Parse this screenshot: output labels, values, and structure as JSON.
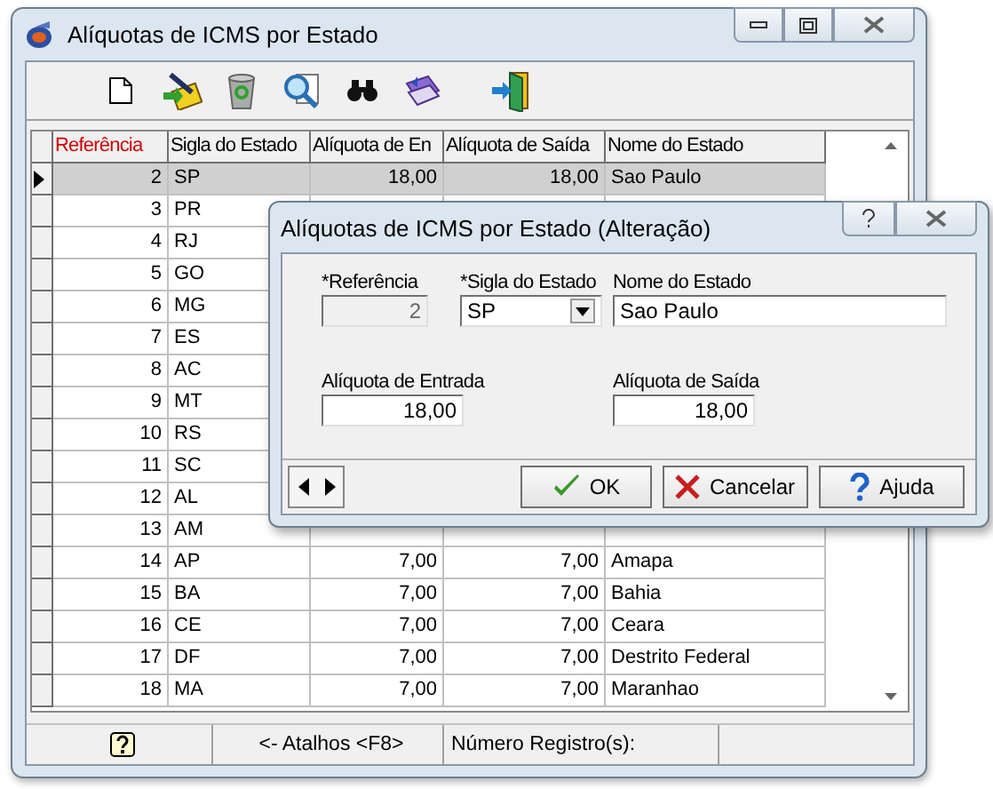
{
  "window": {
    "title": "Alíquotas de ICMS por Estado"
  },
  "table": {
    "columns": [
      "Referência",
      "Sigla do Estado",
      "Alíquota de En",
      "Alíquota de Saída",
      "Nome do Estado"
    ],
    "rows": [
      {
        "ref": "2",
        "sigla": "SP",
        "entrada": "18,00",
        "saida": "18,00",
        "nome": "Sao Paulo",
        "selected": true
      },
      {
        "ref": "3",
        "sigla": "PR",
        "selected": false
      },
      {
        "ref": "4",
        "sigla": "RJ",
        "selected": false
      },
      {
        "ref": "5",
        "sigla": "GO",
        "selected": false
      },
      {
        "ref": "6",
        "sigla": "MG",
        "selected": false
      },
      {
        "ref": "7",
        "sigla": "ES",
        "selected": false
      },
      {
        "ref": "8",
        "sigla": "AC",
        "selected": false
      },
      {
        "ref": "9",
        "sigla": "MT",
        "selected": false
      },
      {
        "ref": "10",
        "sigla": "RS",
        "selected": false
      },
      {
        "ref": "11",
        "sigla": "SC",
        "selected": false
      },
      {
        "ref": "12",
        "sigla": "AL",
        "selected": false
      },
      {
        "ref": "13",
        "sigla": "AM",
        "selected": false
      },
      {
        "ref": "14",
        "sigla": "AP",
        "entrada": "7,00",
        "saida": "7,00",
        "nome": "Amapa",
        "selected": false
      },
      {
        "ref": "15",
        "sigla": "BA",
        "entrada": "7,00",
        "saida": "7,00",
        "nome": "Bahia",
        "selected": false
      },
      {
        "ref": "16",
        "sigla": "CE",
        "entrada": "7,00",
        "saida": "7,00",
        "nome": "Ceara",
        "selected": false
      },
      {
        "ref": "17",
        "sigla": "DF",
        "entrada": "7,00",
        "saida": "7,00",
        "nome": "Destrito Federal",
        "selected": false
      },
      {
        "ref": "18",
        "sigla": "MA",
        "entrada": "7,00",
        "saida": "7,00",
        "nome": "Maranhao",
        "selected": false
      }
    ]
  },
  "status_bar": {
    "shortcut": "<- Atalhos <F8>",
    "count_label": "Número Registro(s):"
  },
  "dialog": {
    "title": "Alíquotas de ICMS por Estado (Alteração)",
    "referencia": {
      "label": "*Referência",
      "value": "2",
      "disabled": true
    },
    "sigla": {
      "label": "*Sigla do Estado",
      "value": "SP"
    },
    "nome": {
      "label": "Nome do Estado",
      "value": "Sao Paulo"
    },
    "entrada": {
      "label": "Alíquota de Entrada",
      "value": "18,00"
    },
    "saida": {
      "label": "Alíquota de Saída",
      "value": "18,00"
    },
    "buttons": [
      {
        "kind": "ok",
        "label": "OK"
      },
      {
        "kind": "cancel",
        "label": "Cancelar"
      },
      {
        "kind": "help",
        "label": "Ajuda"
      }
    ]
  }
}
